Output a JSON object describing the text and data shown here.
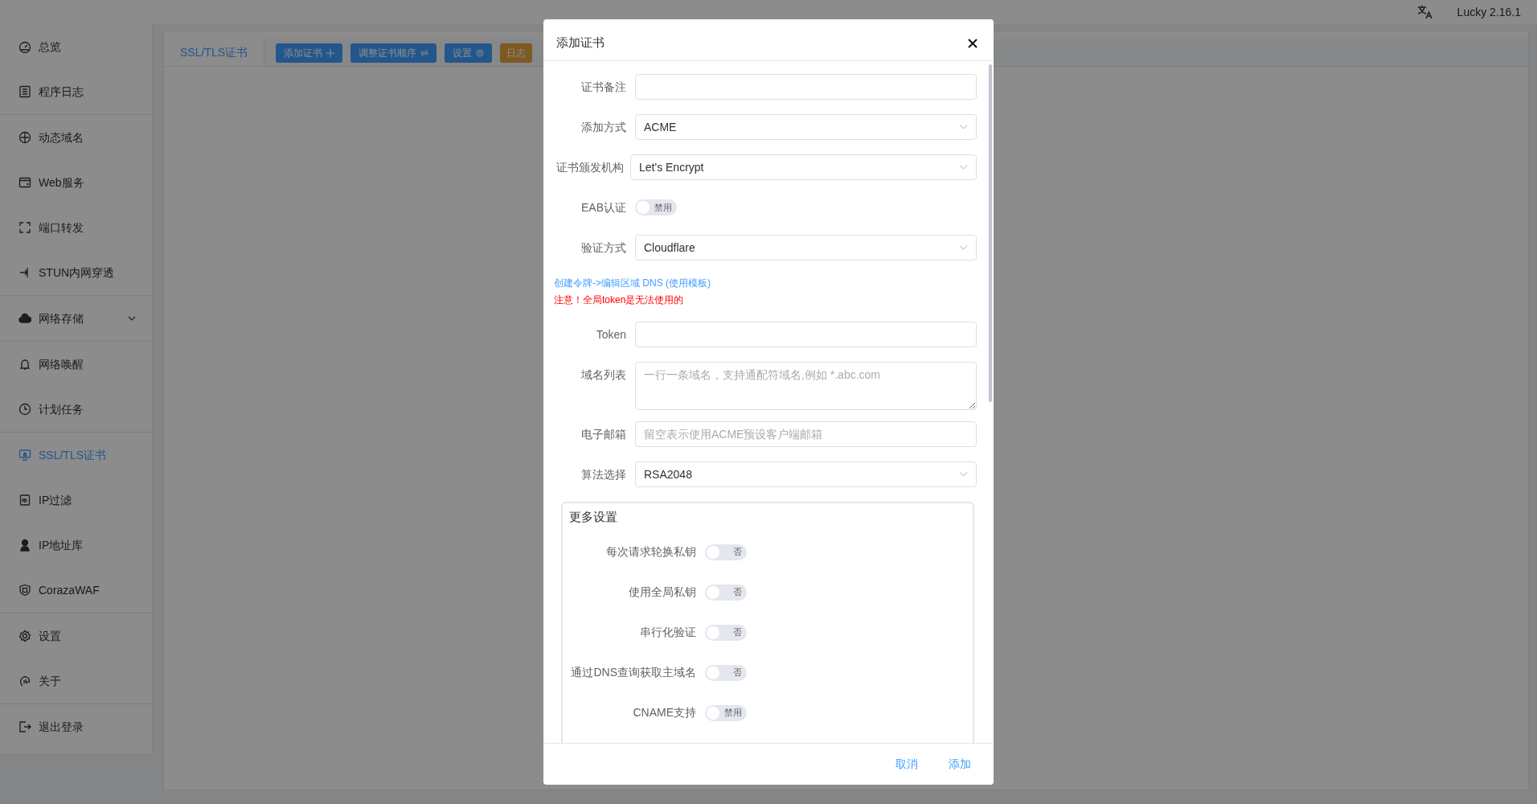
{
  "header": {
    "version": "Lucky 2.16.1"
  },
  "sidebar": {
    "groups": [
      [
        {
          "label": "总览",
          "selected": false,
          "kind": "link"
        },
        {
          "label": "程序日志",
          "selected": false,
          "kind": "link"
        }
      ],
      [
        {
          "label": "动态域名",
          "selected": false,
          "kind": "link"
        },
        {
          "label": "Web服务",
          "selected": false,
          "kind": "link"
        },
        {
          "label": "端口转发",
          "selected": false,
          "kind": "link"
        },
        {
          "label": "STUN内网穿透",
          "selected": false,
          "kind": "link"
        }
      ],
      [
        {
          "label": "网络存储",
          "selected": false,
          "kind": "submenu"
        }
      ],
      [
        {
          "label": "网络唤醒",
          "selected": false,
          "kind": "link"
        },
        {
          "label": "计划任务",
          "selected": false,
          "kind": "link"
        }
      ],
      [
        {
          "label": "SSL/TLS证书",
          "selected": true,
          "kind": "link"
        },
        {
          "label": "IP过滤",
          "selected": false,
          "kind": "link"
        },
        {
          "label": "IP地址库",
          "selected": false,
          "kind": "link"
        },
        {
          "label": "CorazaWAF",
          "selected": false,
          "kind": "link"
        }
      ],
      [
        {
          "label": "设置",
          "selected": false,
          "kind": "link"
        },
        {
          "label": "关于",
          "selected": false,
          "kind": "link"
        }
      ],
      [
        {
          "label": "退出登录",
          "selected": false,
          "kind": "link"
        }
      ]
    ]
  },
  "toolbar": {
    "tab": "SSL/TLS证书",
    "buttons": [
      {
        "label": "添加证书",
        "kind": "primary"
      },
      {
        "label": "调整证书顺序",
        "kind": "primary"
      },
      {
        "label": "设置",
        "kind": "primary"
      },
      {
        "label": "日志",
        "kind": "warning"
      }
    ]
  },
  "dialog": {
    "title": "添加证书",
    "fields": [
      {
        "kind": "input",
        "label": "证书备注"
      },
      {
        "kind": "select",
        "label": "添加方式",
        "value": "ACME"
      },
      {
        "kind": "select",
        "label": "证书颁发机构",
        "value": "Let's Encrypt"
      },
      {
        "kind": "toggle",
        "label": "EAB认证",
        "on": false,
        "text": "禁用"
      },
      {
        "kind": "select",
        "label": "验证方式",
        "value": "Cloudflare"
      },
      {
        "kind": "link",
        "text": "创建令牌->编辑区域 DNS (使用模板)"
      },
      {
        "kind": "warning",
        "text": "注意！全局token是无法使用的"
      },
      {
        "kind": "input",
        "label": "Token"
      },
      {
        "kind": "textarea",
        "label": "域名列表",
        "placeholder": "一行一条域名，支持通配符域名,例如 *.abc.com"
      },
      {
        "kind": "input",
        "label": "电子邮箱",
        "placeholder": "留空表示使用ACME预设客户端邮箱"
      },
      {
        "kind": "select",
        "label": "算法选择",
        "value": "RSA2048"
      }
    ],
    "more": {
      "title": "更多设置",
      "toggles": [
        {
          "label": "每次请求轮换私钥",
          "on": false,
          "text": "否"
        },
        {
          "label": "使用全局私钥",
          "on": false,
          "text": "否"
        },
        {
          "label": "串行化验证",
          "on": false,
          "text": "否"
        },
        {
          "label": "通过DNS查询获取主域名",
          "on": false,
          "text": "否"
        },
        {
          "label": "CNAME支持",
          "on": false,
          "text": "禁用"
        }
      ]
    },
    "buttons": [
      "取消",
      "添加"
    ]
  }
}
